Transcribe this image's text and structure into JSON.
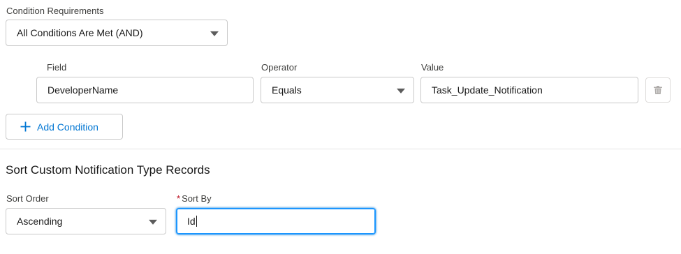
{
  "condition_requirements": {
    "label": "Condition Requirements",
    "selected": "All Conditions Are Met (AND)"
  },
  "condition_row": {
    "field_label": "Field",
    "field_value": "DeveloperName",
    "operator_label": "Operator",
    "operator_value": "Equals",
    "value_label": "Value",
    "value_value": "Task_Update_Notification",
    "delete_icon": "trash-icon"
  },
  "add_condition": {
    "icon": "plus-icon",
    "label": "Add Condition"
  },
  "sort_section": {
    "title": "Sort Custom Notification Type Records",
    "sort_order_label": "Sort Order",
    "sort_order_value": "Ascending",
    "sort_by_required": "*",
    "sort_by_label": "Sort By",
    "sort_by_value": "Id"
  },
  "colors": {
    "brand": "#0176d3",
    "focus": "#1b96ff",
    "required": "#ba0517",
    "border": "#c9c9c9"
  }
}
